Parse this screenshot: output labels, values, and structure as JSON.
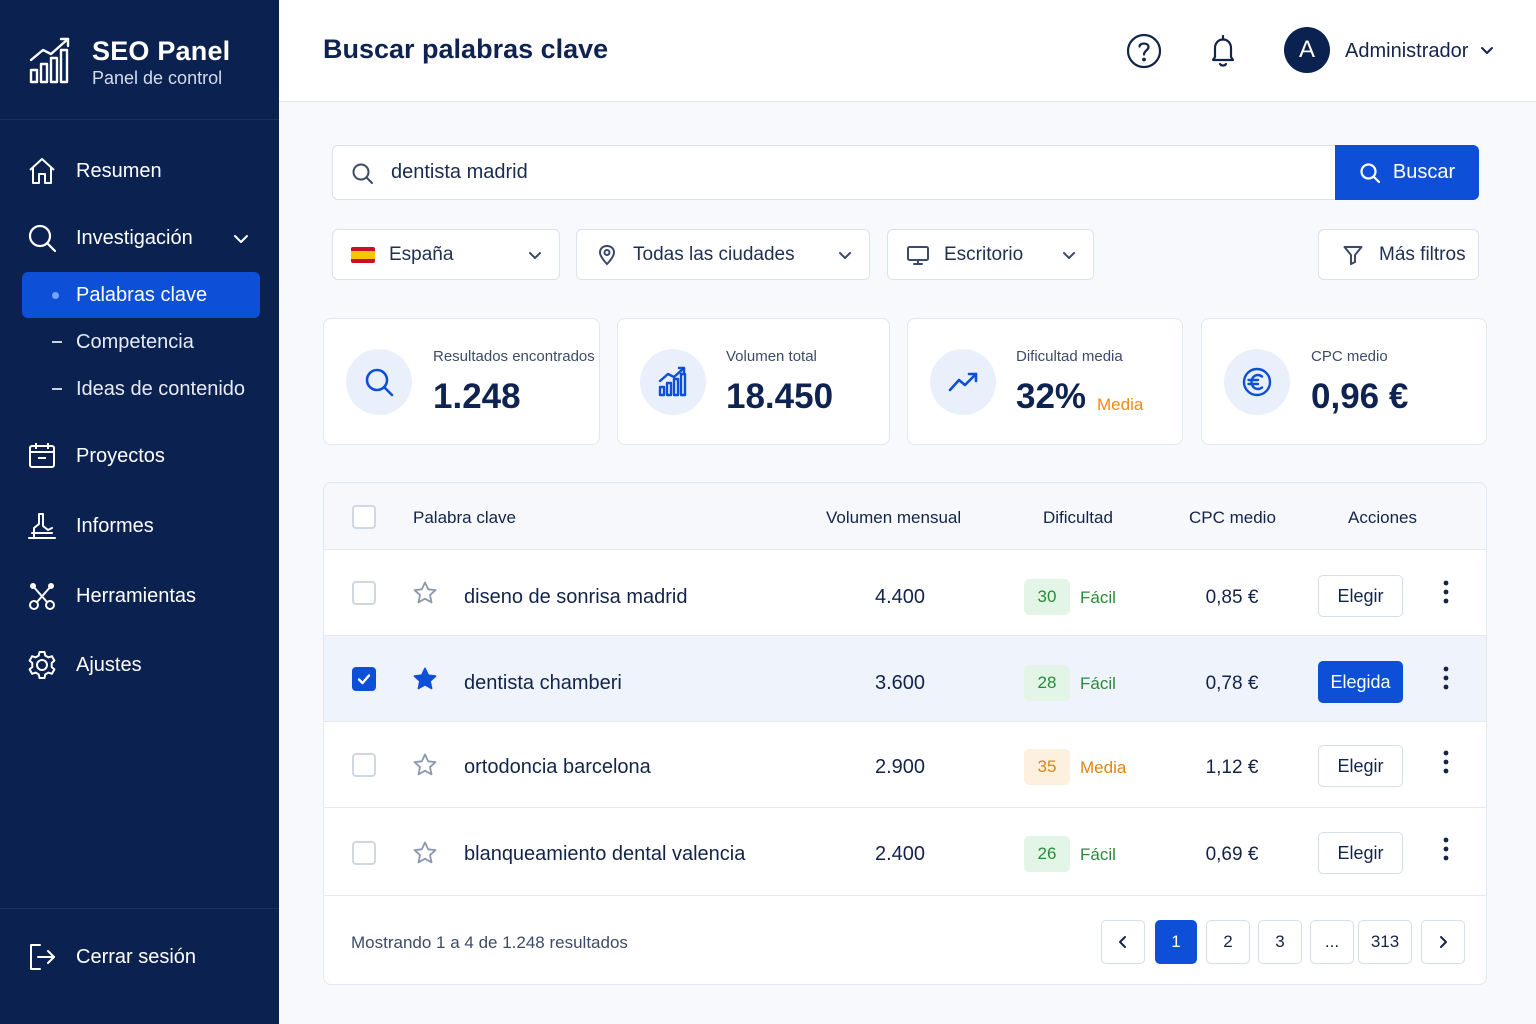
{
  "brand": {
    "title": "SEO Panel",
    "subtitle": "Panel de control"
  },
  "sidebar": {
    "items": [
      {
        "label": "Resumen",
        "icon": "home-icon"
      },
      {
        "label": "Investigación",
        "icon": "search-icon"
      },
      {
        "label": "Proyectos",
        "icon": "folder-icon"
      },
      {
        "label": "Informes",
        "icon": "chart-icon"
      },
      {
        "label": "Herramientas",
        "icon": "tools-icon"
      },
      {
        "label": "Ajustes",
        "icon": "gear-icon"
      }
    ],
    "subitems": [
      {
        "label": "Palabras clave",
        "active": true
      },
      {
        "label": "Competencia",
        "active": false
      },
      {
        "label": "Ideas de contenido",
        "active": false
      }
    ],
    "logout": "Cerrar sesión"
  },
  "header": {
    "title": "Buscar palabras clave",
    "avatar_letter": "A",
    "user": "Administrador"
  },
  "search": {
    "value": "dentista madrid",
    "button": "Buscar"
  },
  "filters": {
    "country": "España",
    "city": "Todas las ciudades",
    "device": "Escritorio",
    "more": "Más filtros"
  },
  "stats": [
    {
      "label": "Resultados encontrados",
      "value": "1.248",
      "icon": "search-icon"
    },
    {
      "label": "Volumen total",
      "value": "18.450",
      "icon": "bar-chart-icon"
    },
    {
      "label": "Dificultad media",
      "value": "32%",
      "tag": "Media",
      "icon": "trend-up-icon"
    },
    {
      "label": "CPC medio",
      "value": "0,96 €",
      "icon": "euro-icon"
    }
  ],
  "table": {
    "headers": [
      "Palabra clave",
      "Volumen mensual",
      "Dificultad",
      "CPC medio",
      "Acciones"
    ],
    "rows": [
      {
        "keyword": "diseno de sonrisa madrid",
        "volume": "4.400",
        "difficulty": "30",
        "difficulty_label": "Fácil",
        "level": "easy",
        "cpc": "0,85 €",
        "action": "Elegir",
        "selected": false
      },
      {
        "keyword": "dentista chamberi",
        "volume": "3.600",
        "difficulty": "28",
        "difficulty_label": "Fácil",
        "level": "easy",
        "cpc": "0,78 €",
        "action": "Elegida",
        "selected": true
      },
      {
        "keyword": "ortodoncia barcelona",
        "volume": "2.900",
        "difficulty": "35",
        "difficulty_label": "Media",
        "level": "med",
        "cpc": "1,12 €",
        "action": "Elegir",
        "selected": false
      },
      {
        "keyword": "blanqueamiento dental valencia",
        "volume": "2.400",
        "difficulty": "26",
        "difficulty_label": "Fácil",
        "level": "easy",
        "cpc": "0,69 €",
        "action": "Elegir",
        "selected": false
      }
    ],
    "footer": "Mostrando 1 a 4 de 1.248 resultados",
    "pages": [
      "1",
      "2",
      "3",
      "...",
      "313"
    ],
    "current_page": "1"
  },
  "colors": {
    "sidebar": "#0b2150",
    "accent": "#0d4fd6",
    "easy": "#2a8a3c",
    "medium": "#e08410"
  }
}
